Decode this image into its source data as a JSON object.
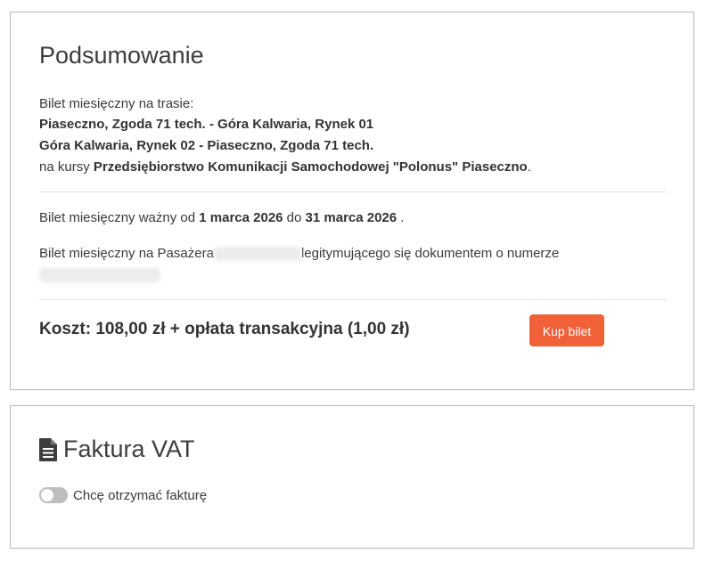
{
  "summary": {
    "title": "Podsumowanie",
    "route_intro": "Bilet miesięczny na trasie:",
    "route_1": "Piaseczno, Zgoda 71 tech. - Góra Kalwaria, Rynek 01",
    "route_2": "Góra Kalwaria, Rynek 02 - Piaseczno, Zgoda 71 tech.",
    "carrier_prefix": "na kursy",
    "carrier_name": "Przedsiębiorstwo Komunikacji Samochodowej \"Polonus\" Piaseczno",
    "carrier_suffix": ".",
    "validity_prefix": "Bilet miesięczny ważny od",
    "valid_from": "1 marca 2026",
    "validity_mid": "do",
    "valid_to": "31 marca 2026",
    "validity_suffix": ".",
    "passenger_prefix": "Bilet miesięczny na Pasażera",
    "passenger_suffix": "legitymującego się dokumentem o numerze",
    "cost": "Koszt: 108,00 zł + opłata transakcyjna (1,00 zł)",
    "buy_button": "Kup bilet"
  },
  "invoice": {
    "title": "Faktura VAT",
    "toggle_label": "Chcę otrzymać fakturę",
    "toggle_on": false,
    "icon": "file-text-icon"
  },
  "colors": {
    "accent": "#f0613a",
    "border": "#b9b9b9",
    "toggle_off": "#bdbdbd"
  }
}
